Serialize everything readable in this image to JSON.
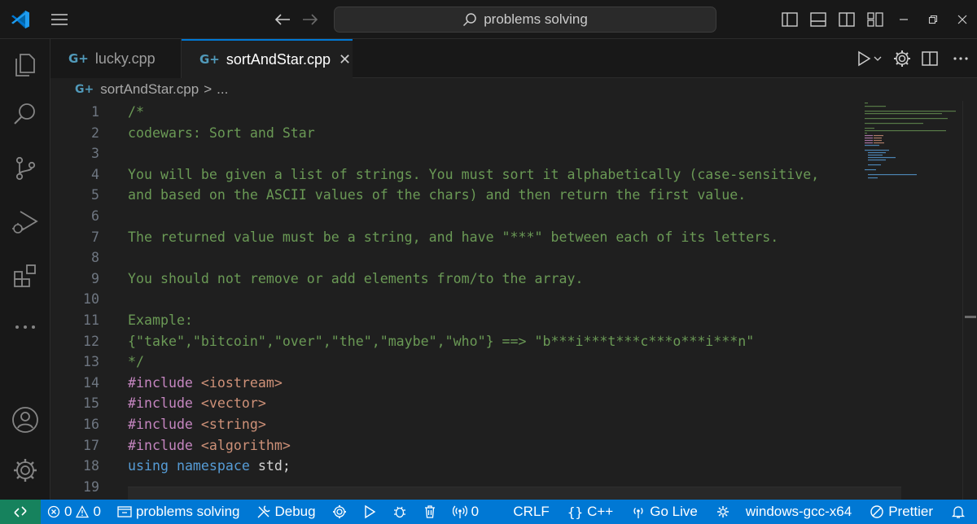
{
  "titlebar": {
    "search_text": "problems solving",
    "icons": [
      "vscode-logo-icon",
      "menu-icon",
      "back-arrow-icon",
      "forward-arrow-icon",
      "search-icon",
      "toggle-sidebar-icon",
      "toggle-panel-icon",
      "toggle-secondary-sidebar-icon",
      "customize-layout-icon",
      "minimize-icon",
      "restore-icon",
      "close-icon"
    ]
  },
  "activity_bar": {
    "items": [
      "explorer-icon",
      "search-icon",
      "source-control-icon",
      "run-debug-icon",
      "extensions-icon",
      "more-icon",
      "accounts-icon",
      "settings-gear-icon"
    ]
  },
  "tabs": [
    {
      "label": "lucky.cpp",
      "active": false,
      "icon": "cpp-file-icon"
    },
    {
      "label": "sortAndStar.cpp",
      "active": true,
      "icon": "cpp-file-icon",
      "close": "✕"
    }
  ],
  "breadcrumb": {
    "file": "sortAndStar.cpp",
    "separator": ">",
    "more": "..."
  },
  "editor": {
    "lines": [
      {
        "n": "1",
        "text": "/*"
      },
      {
        "n": "2",
        "text": "codewars: Sort and Star"
      },
      {
        "n": "3",
        "text": ""
      },
      {
        "n": "4",
        "text": "You will be given a list of strings. You must sort it alphabetically (case-sensitive,"
      },
      {
        "n": "5",
        "text": "and based on the ASCII values of the chars) and then return the first value."
      },
      {
        "n": "6",
        "text": ""
      },
      {
        "n": "7",
        "text": "The returned value must be a string, and have \"***\" between each of its letters."
      },
      {
        "n": "8",
        "text": ""
      },
      {
        "n": "9",
        "text": "You should not remove or add elements from/to the array."
      },
      {
        "n": "10",
        "text": ""
      },
      {
        "n": "11",
        "text": "Example:"
      },
      {
        "n": "12",
        "text": "{\"take\",\"bitcoin\",\"over\",\"the\",\"maybe\",\"who\"} ==> \"b***i***t***c***o***i***n\""
      },
      {
        "n": "13",
        "text": "*/"
      },
      {
        "n": "14",
        "pre": "#include ",
        "inc": "<iostream>"
      },
      {
        "n": "15",
        "pre": "#include ",
        "inc": "<vector>"
      },
      {
        "n": "16",
        "pre": "#include ",
        "inc": "<string>"
      },
      {
        "n": "17",
        "pre": "#include ",
        "inc": "<algorithm>"
      },
      {
        "n": "18",
        "kw1": "using",
        "kw2": "namespace",
        "rest": " std;"
      },
      {
        "n": "19",
        "text": ""
      }
    ]
  },
  "statusbar": {
    "remote_icon": "remote-icon",
    "errors": "0",
    "warnings": "0",
    "folder": "problems solving",
    "debug": "Debug",
    "ports": "0",
    "eol": "CRLF",
    "language": "C++",
    "go_live": "Go Live",
    "config": "windows-gcc-x64",
    "prettier": "Prettier"
  },
  "colors": {
    "accent": "#0078d4",
    "remote": "#16825d",
    "comment": "#6a9955",
    "keyword": "#569cd6",
    "string": "#ce9178",
    "preprocessor": "#c586c0"
  }
}
